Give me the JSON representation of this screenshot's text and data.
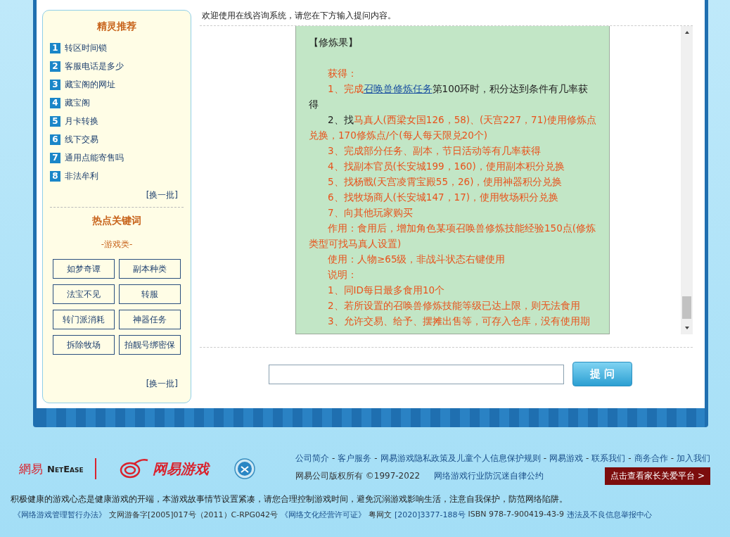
{
  "sidebar": {
    "recommend": {
      "title": "精灵推荐",
      "items": [
        {
          "number": "1",
          "label": "转区时间锁"
        },
        {
          "number": "2",
          "label": "客服电话是多少"
        },
        {
          "number": "3",
          "label": "藏宝阁的网址"
        },
        {
          "number": "4",
          "label": "藏宝阁"
        },
        {
          "number": "5",
          "label": "月卡转换"
        },
        {
          "number": "6",
          "label": "线下交易"
        },
        {
          "number": "7",
          "label": "通用点能寄售吗"
        },
        {
          "number": "8",
          "label": "非法牟利"
        }
      ],
      "refresh": "[换一批]"
    },
    "keywords": {
      "title": "热点关键词",
      "category": "-游戏类-",
      "items": [
        "如梦奇谭",
        "副本种类",
        "法宝不见",
        "转服",
        "转门派消耗",
        "神器任务",
        "拆除牧场",
        "拍靓号绑密保"
      ],
      "refresh": "[换一批]"
    }
  },
  "welcome": "欢迎使用在线咨询系统，请您在下方输入提问内容。",
  "answer": {
    "title": "【修炼果】",
    "paragraphs": [
      [
        {
          "kind": "accent",
          "text": "获得："
        }
      ],
      [
        {
          "kind": "accent",
          "text": "1、完成"
        },
        {
          "kind": "link",
          "text": "召唤兽修炼任务"
        },
        {
          "kind": "plain",
          "text": "第100环时，积分达到条件有几率获得"
        }
      ],
      [
        {
          "kind": "plain",
          "text": "2、找"
        },
        {
          "kind": "accent",
          "text": "马真人(西梁女国126，58)、(天宫227，71)使用修炼点兑换，170修炼点/个(每人每天限兑20个)"
        }
      ],
      [
        {
          "kind": "accent",
          "text": "3、完成部分任务、副本，节日活动等有几率获得"
        }
      ],
      [
        {
          "kind": "accent",
          "text": "4、找副本官员(长安城199，160)，使用副本积分兑换"
        }
      ],
      [
        {
          "kind": "accent",
          "text": "5、找杨戬(天宫凌霄宝殿55，26)，使用神器积分兑换"
        }
      ],
      [
        {
          "kind": "accent",
          "text": "6、找牧场商人(长安城147，17)，使用牧场积分兑换"
        }
      ],
      [
        {
          "kind": "accent",
          "text": "7、向其他玩家购买"
        }
      ],
      [
        {
          "kind": "accent",
          "text": "作用：食用后，增加角色某项召唤兽修炼技能经验150点(修炼类型可找马真人设置)"
        }
      ],
      [
        {
          "kind": "accent",
          "text": "使用：人物≥65级，非战斗状态右键使用"
        }
      ],
      [
        {
          "kind": "accent",
          "text": "说明："
        }
      ],
      [
        {
          "kind": "accent",
          "text": "1、同ID每日最多食用10个"
        }
      ],
      [
        {
          "kind": "accent",
          "text": "2、若所设置的召唤兽修炼技能等级已达上限，则无法食用"
        }
      ],
      [
        {
          "kind": "accent",
          "text": "3、允许交易、给予、摆摊出售等，可存入仓库，没有使用期"
        }
      ]
    ]
  },
  "ask": {
    "button": "提 问"
  },
  "footer": {
    "netease": "網易",
    "netease_en": "NetEase",
    "game_logo": "网易游戏",
    "link_separator": "-",
    "links": [
      "公司简介",
      "客户服务",
      "网易游戏隐私政策及儿童个人信息保护规则",
      "网易游戏",
      "联系我们",
      "商务合作",
      "加入我们"
    ],
    "copyright": "网易公司版权所有 ©1997-2022",
    "pact": "网络游戏行业防沉迷自律公约",
    "parent_button": "点击查看家长关爱平台 >",
    "notice": "积极健康的游戏心态是健康游戏的开端，本游戏故事情节设置紧凑，请您合理控制游戏时间，避免沉溺游戏影响生活，注意自我保护，防范网络陷阱。",
    "licenses": [
      {
        "kind": "link",
        "text": "《网络游戏管理暂行办法》"
      },
      {
        "kind": "plain",
        "text": "文网游备字[2005]017号（2011）C-RPG042号"
      },
      {
        "kind": "link",
        "text": "《网络文化经营许可证》"
      },
      {
        "kind": "plain",
        "text": "粤网文"
      },
      {
        "kind": "link",
        "text": "[2020]3377-188号"
      },
      {
        "kind": "plain",
        "text": "ISBN 978-7-900419-43-9"
      },
      {
        "kind": "link",
        "text": "违法及不良信息举报中心"
      }
    ]
  }
}
